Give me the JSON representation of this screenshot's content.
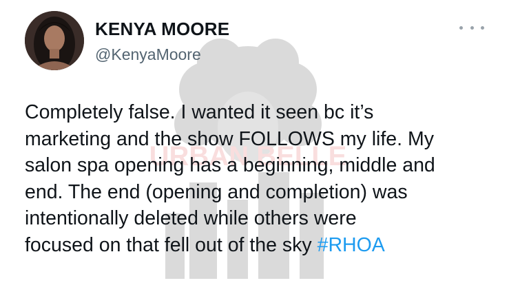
{
  "tweet": {
    "display_name": "KENYA MOORE",
    "handle": "@KenyaMoore",
    "more_icon": "more-horizontal-icon",
    "text_lines": [
      "Completely false.  I wanted it seen bc it’s",
      "marketing and the show FOLLOWS my life. My",
      "salon spa opening has a beginning, middle and",
      "end. The end (opening and completion) was",
      "intentionally deleted while others were",
      "focused on that fell out of the sky "
    ],
    "hashtag": "#RHOA"
  },
  "watermark": {
    "text": "URBAN BELLE"
  },
  "colors": {
    "hashtag": "#1d9bf0",
    "handle": "#536471",
    "text": "#0f1419",
    "watermark_text": "#e0373b"
  }
}
